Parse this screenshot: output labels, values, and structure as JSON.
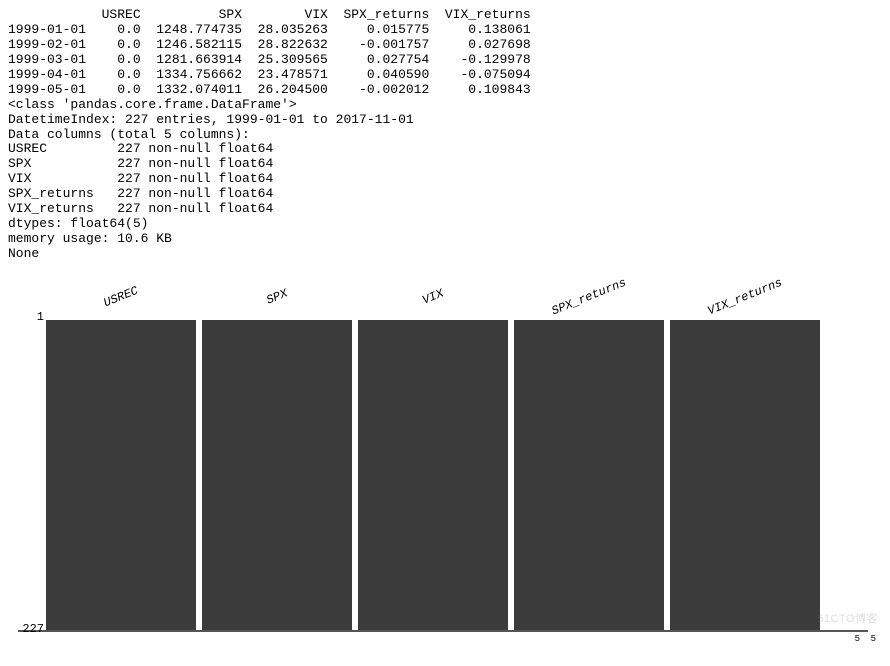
{
  "table": {
    "columns": [
      "USREC",
      "SPX",
      "VIX",
      "SPX_returns",
      "VIX_returns"
    ],
    "rows": [
      {
        "date": "1999-01-01",
        "USREC": "0.0",
        "SPX": "1248.774735",
        "VIX": "28.035263",
        "SPX_returns": "0.015775",
        "VIX_returns": "0.138061"
      },
      {
        "date": "1999-02-01",
        "USREC": "0.0",
        "SPX": "1246.582115",
        "VIX": "28.822632",
        "SPX_returns": "-0.001757",
        "VIX_returns": "0.027698"
      },
      {
        "date": "1999-03-01",
        "USREC": "0.0",
        "SPX": "1281.663914",
        "VIX": "25.309565",
        "SPX_returns": "0.027754",
        "VIX_returns": "-0.129978"
      },
      {
        "date": "1999-04-01",
        "USREC": "0.0",
        "SPX": "1334.756662",
        "VIX": "23.478571",
        "SPX_returns": "0.040590",
        "VIX_returns": "-0.075094"
      },
      {
        "date": "1999-05-01",
        "USREC": "0.0",
        "SPX": "1332.074011",
        "VIX": "26.204500",
        "SPX_returns": "-0.002012",
        "VIX_returns": "0.109843"
      }
    ]
  },
  "info": {
    "class_line": "<class 'pandas.core.frame.DataFrame'>",
    "index_line": "DatetimeIndex: 227 entries, 1999-01-01 to 2017-11-01",
    "cols_header": "Data columns (total 5 columns):",
    "cols": [
      {
        "name": "USREC",
        "desc": "227 non-null float64"
      },
      {
        "name": "SPX",
        "desc": "227 non-null float64"
      },
      {
        "name": "VIX",
        "desc": "227 non-null float64"
      },
      {
        "name": "SPX_returns",
        "desc": "227 non-null float64"
      },
      {
        "name": "VIX_returns",
        "desc": "227 non-null float64"
      }
    ],
    "dtypes": "dtypes: float64(5)",
    "memory": "memory usage: 10.6 KB",
    "none": "None"
  },
  "chart_data": {
    "type": "bar",
    "categories": [
      "USREC",
      "SPX",
      "VIX",
      "SPX_returns",
      "VIX_returns"
    ],
    "values": [
      227,
      227,
      227,
      227,
      227
    ],
    "title": "",
    "xlabel": "",
    "ylabel": "",
    "ylim": [
      1,
      227
    ],
    "ylim_top_label": "1",
    "ylim_bottom_label": "227",
    "right_tick_a": "5",
    "right_tick_b": "5"
  },
  "watermark": "51CTO博客"
}
